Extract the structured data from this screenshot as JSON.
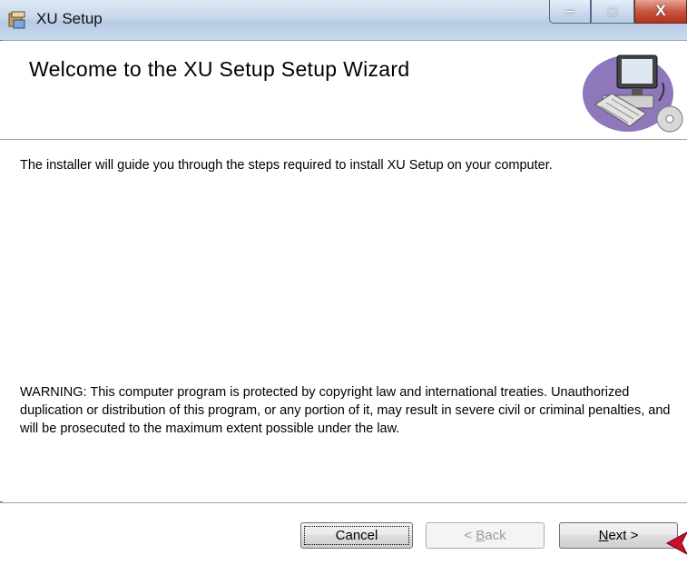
{
  "window": {
    "title": "XU Setup",
    "controls": {
      "minimize": "minimize",
      "maximize": "maximize",
      "close": "close"
    }
  },
  "header": {
    "title": "Welcome to the XU Setup Setup Wizard",
    "icon": "computer-setup-icon"
  },
  "body": {
    "intro": "The installer will guide you through the steps required to install XU Setup on your computer.",
    "warning": "WARNING: This computer program is protected by copyright law and international treaties. Unauthorized duplication or distribution of this program, or any portion of it, may result in severe civil or criminal penalties, and will be prosecuted to the maximum extent possible under the law."
  },
  "buttons": {
    "cancel": {
      "label": "Cancel",
      "enabled": true
    },
    "back": {
      "prefix": "< ",
      "accel": "B",
      "rest": "ack",
      "enabled": false
    },
    "next": {
      "accel": "N",
      "rest": "ext >",
      "enabled": true
    }
  },
  "colors": {
    "titlebar": "#c6d6ea",
    "close_button": "#c9563f",
    "disabled_text": "#9c9c9c",
    "pointer_arrow": "#c8102e"
  }
}
